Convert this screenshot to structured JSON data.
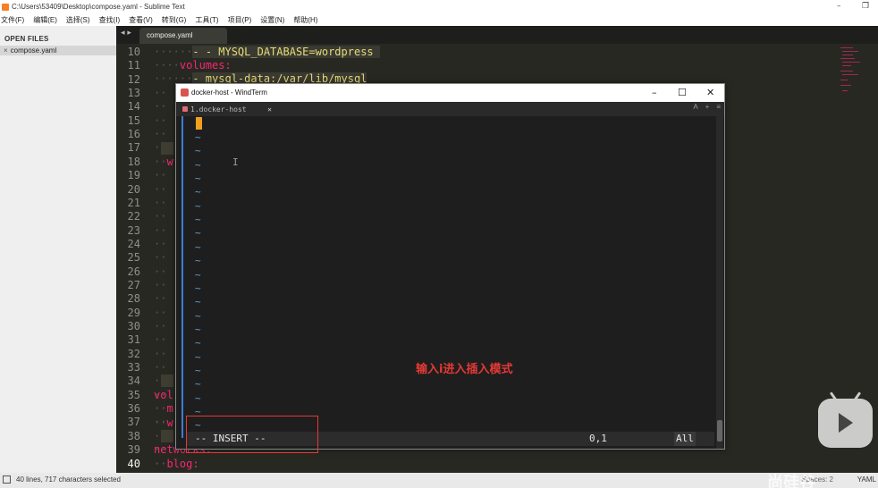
{
  "sublime": {
    "title": "C:\\Users\\53409\\Desktop\\compose.yaml - Sublime Text",
    "menu": [
      "文件(F)",
      "编辑(E)",
      "选择(S)",
      "查找(I)",
      "查看(V)",
      "转到(G)",
      "工具(T)",
      "项目(P)",
      "设置(N)",
      "帮助(H)"
    ],
    "sidebar_header": "OPEN FILES",
    "open_file": "compose.yaml",
    "tab": "compose.yaml",
    "status_left": "40 lines, 717 characters selected",
    "status_mid": "Spaces: 2",
    "status_right": "YAML",
    "line_numbers": [
      "10",
      "11",
      "12",
      "13",
      "14",
      "15",
      "16",
      "17",
      "18",
      "19",
      "20",
      "21",
      "22",
      "23",
      "24",
      "25",
      "26",
      "27",
      "28",
      "29",
      "30",
      "31",
      "32",
      "33",
      "34",
      "35",
      "36",
      "37",
      "38",
      "39",
      "40"
    ],
    "visible_code": {
      "l10": "- MYSQL_DATABASE=wordpress",
      "l11": "volumes:",
      "l12": "- mysql-data:/var/lib/mysql",
      "l18": "w",
      "l35": "vol",
      "l36": "m",
      "l37": "w",
      "l39": "networks:",
      "l40": "blog:"
    }
  },
  "windterm": {
    "title": "docker-host - WindTerm",
    "tab_label": "1.docker-host",
    "tools": [
      "A",
      "+",
      "≡"
    ],
    "tilde_char": "~",
    "annotation": "输入i进入插入模式",
    "mode": "-- INSERT --",
    "position": "0,1",
    "scroll": "All"
  },
  "overlay": {
    "watermark": "尚硅谷"
  },
  "colors": {
    "editor_bg": "#272822",
    "keyword": "#f92672",
    "string": "#e6db74",
    "term_bg": "#1e1e1e",
    "tilde": "#5fa3d9",
    "annotation_red": "#e53935",
    "cursor": "#f0a020"
  }
}
